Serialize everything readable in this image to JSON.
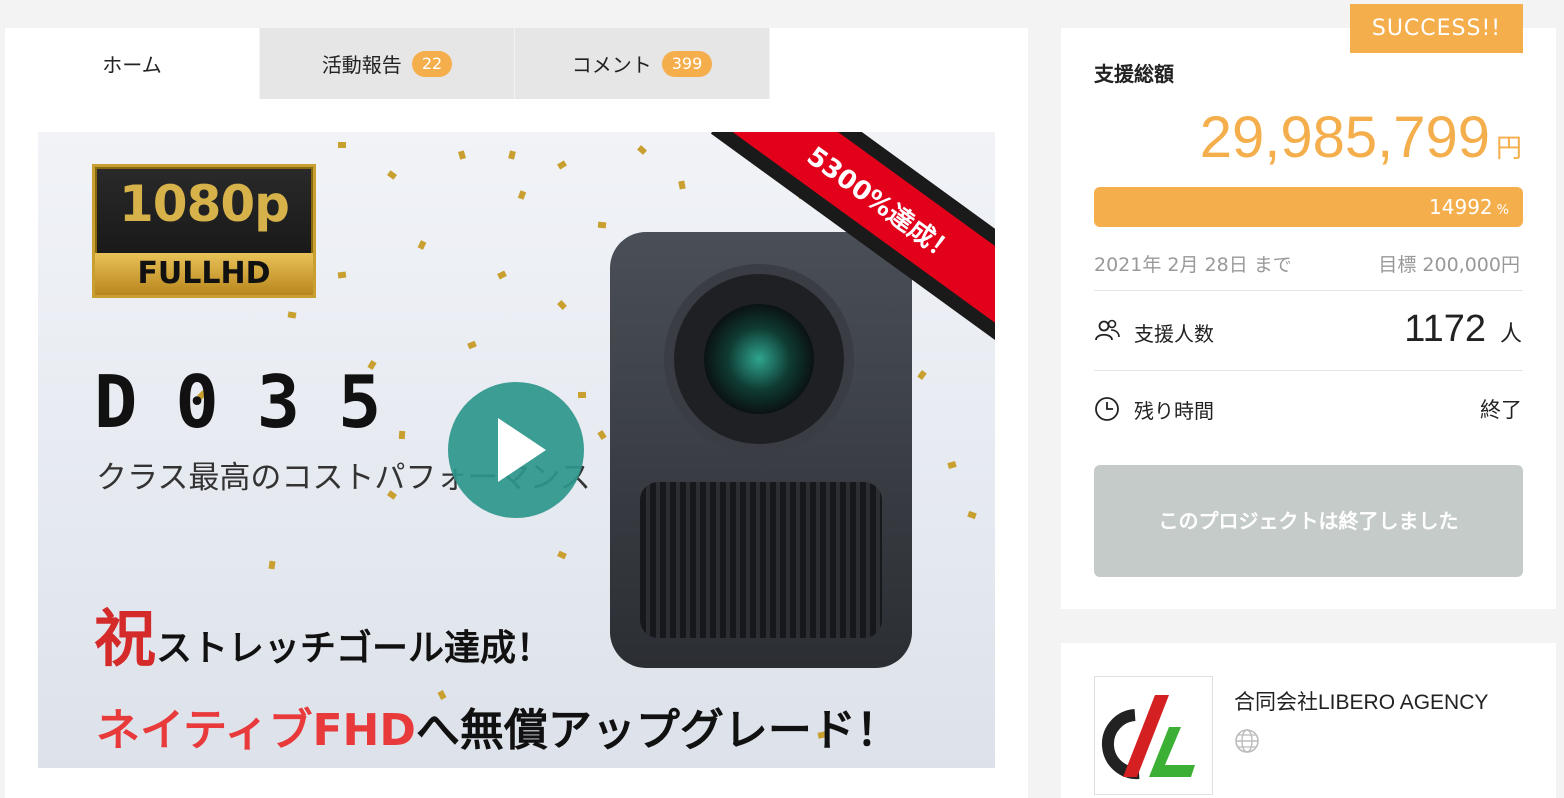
{
  "tabs": [
    {
      "label": "ホーム"
    },
    {
      "label": "活動報告",
      "count": "22"
    },
    {
      "label": "コメント",
      "count": "399"
    }
  ],
  "hero": {
    "badge_top": "1080p",
    "badge_bottom": "FULLHD",
    "model": "D035",
    "tagline": "クラス最高のコストパフォーマンス",
    "celebrate_big": "祝",
    "celebrate_rest": "ストレッチゴール達成！",
    "upgrade_red": "ネイティブFHD",
    "upgrade_rest": "へ無償アップグレード！",
    "ribbon": "5300%達成！"
  },
  "sidebar": {
    "status_badge": "SUCCESS!!",
    "funding_label": "支援総額",
    "amount": "29,985,799",
    "amount_unit": "円",
    "progress_percent": 14992,
    "progress_text": "14992",
    "progress_unit": "%",
    "deadline": "2021年 2月 28日 まで",
    "goal": "目標 200,000円",
    "backers_label": "支援人数",
    "backers_value": "1172",
    "backers_unit": "人",
    "time_label": "残り時間",
    "time_value": "終了",
    "ended_button": "このプロジェクトは終了しました"
  },
  "owner": {
    "name": "合同会社LIBERO AGENCY"
  },
  "colors": {
    "accent": "#f5ae4c",
    "disabled": "#c5cbc9",
    "play": "#2c968c"
  }
}
